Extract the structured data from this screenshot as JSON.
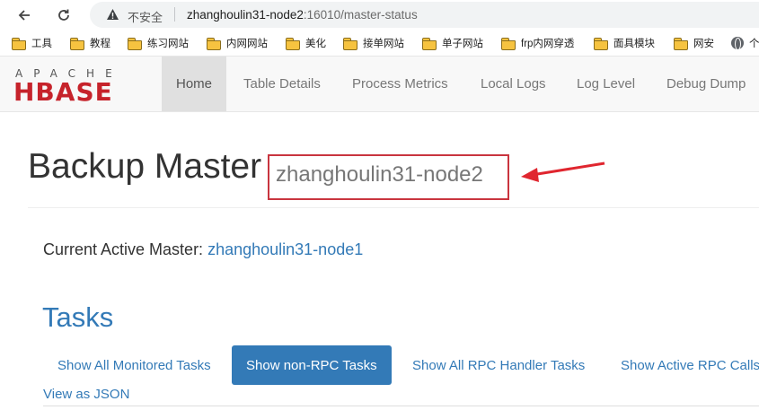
{
  "browser": {
    "security_label": "不安全",
    "url_host": "zhanghoulin31-node2",
    "url_rest": ":16010/master-status"
  },
  "bookmarks": [
    {
      "label": "工具",
      "icon": "folder-icon"
    },
    {
      "label": "教程",
      "icon": "folder-icon"
    },
    {
      "label": "练习网站",
      "icon": "folder-icon"
    },
    {
      "label": "内网网站",
      "icon": "folder-icon"
    },
    {
      "label": "美化",
      "icon": "folder-icon"
    },
    {
      "label": "接单网站",
      "icon": "folder-icon"
    },
    {
      "label": "单子网站",
      "icon": "folder-icon"
    },
    {
      "label": "frp内网穿透",
      "icon": "folder-icon"
    },
    {
      "label": "面具模块",
      "icon": "folder-icon"
    },
    {
      "label": "网安",
      "icon": "folder-icon"
    },
    {
      "label": "个",
      "icon": "globe-icon"
    }
  ],
  "header": {
    "logo_top": "APACHE",
    "logo_main": "HBASE",
    "nav": [
      "Home",
      "Table Details",
      "Process Metrics",
      "Local Logs",
      "Log Level",
      "Debug Dump"
    ]
  },
  "main": {
    "title": "Backup Master",
    "title_host": "zhanghoulin31-node2",
    "active_master_label": "Current Active Master:",
    "active_master_value": "zhanghoulin31-node1",
    "tasks_heading": "Tasks",
    "task_tabs": [
      "Show All Monitored Tasks",
      "Show non-RPC Tasks",
      "Show All RPC Handler Tasks",
      "Show Active RPC Calls"
    ],
    "view_json": "View as JSON"
  },
  "colors": {
    "link": "#337ab7",
    "annotation_red": "#c9353f",
    "logo_red": "#c6232b"
  }
}
